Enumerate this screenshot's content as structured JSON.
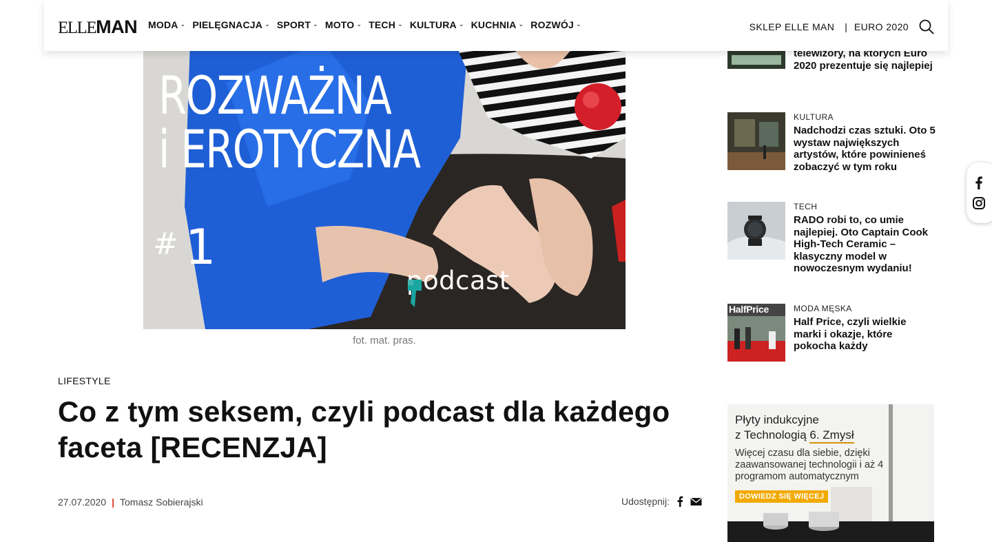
{
  "header": {
    "logo_elle": "ELLE",
    "logo_man": "MAN",
    "nav": [
      {
        "label": "MODA"
      },
      {
        "label": "PIELĘGNACJA"
      },
      {
        "label": "SPORT"
      },
      {
        "label": "MOTO"
      },
      {
        "label": "TECH"
      },
      {
        "label": "KULTURA"
      },
      {
        "label": "KUCHNIA"
      },
      {
        "label": "ROZWÓJ"
      }
    ],
    "shop_link": "SKLEP ELLE MAN",
    "separator": "|",
    "euro_link": "EURO 2020",
    "search_icon": "search-icon"
  },
  "hero": {
    "title_line1": "ROZWAŻNA",
    "title_line2": "i EROTYCZNA",
    "hash": "#",
    "number": "1",
    "podcast_label": "podcast",
    "caption": "fot. mat. pras."
  },
  "article": {
    "category": "LIFESTYLE",
    "title": "Co z tym seksem, czyli podcast dla każdego faceta [RECENZJA]",
    "date": "27.07.2020",
    "meta_separator": "|",
    "author": "Tomasz Sobierajski",
    "share_label": "Udostępnij:",
    "share_icons": [
      "facebook-icon",
      "mail-icon"
    ]
  },
  "sidebar": {
    "items": [
      {
        "category": "",
        "title": "telewizory, na których Euro 2020 prezentuje się najlepiej"
      },
      {
        "category": "KULTURA",
        "title": "Nadchodzi czas sztuki. Oto 5 wystaw największych artystów, które powinieneś zobaczyć w tym roku"
      },
      {
        "category": "TECH",
        "title": "RADO robi to, co umie najlepiej. Oto Captain Cook High-Tech Ceramic – klasyczny model w nowoczesnym wydaniu!"
      },
      {
        "category": "MODA MĘSKA",
        "title": "Half Price, czyli wielkie marki i okazje, które pokocha każdy",
        "thumb_text": "HalfPrice"
      }
    ]
  },
  "ad": {
    "headline_1": "Płyty indukcyjne",
    "headline_2_prefix": "z Technologią ",
    "headline_2_highlight": "6. Zmysł",
    "body": "Więcej czasu dla siebie, dzięki zaawansowanej technologii i aż 4 programom automatycznym",
    "cta": "DOWIEDZ SIĘ WIĘCEJ",
    "accent_color": "#f2a900"
  },
  "floating_social": {
    "icons": [
      "facebook-icon",
      "instagram-icon"
    ]
  },
  "colors": {
    "accent_red": "#e23b2a",
    "podcast_teal": "#1aa6a0"
  }
}
